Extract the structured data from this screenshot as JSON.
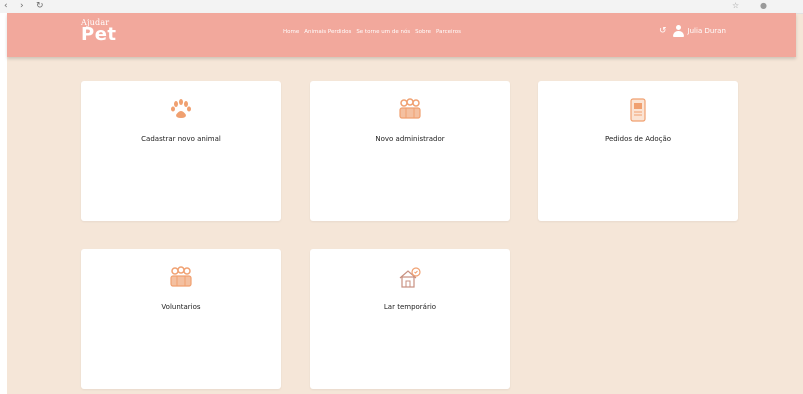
{
  "header": {
    "logo_small": "Ajudar",
    "logo_main": "Pet",
    "nav": [
      "Home",
      "Animais Perdidos",
      "Se torne um de nós",
      "Sobre",
      "Parceiros"
    ],
    "user_name": "Julia Duran",
    "bg_color": "#f2a89c"
  },
  "cards": [
    {
      "label": "Cadastrar novo animal",
      "icon": "paw-icon"
    },
    {
      "label": "Novo administrador",
      "icon": "people-icon"
    },
    {
      "label": "Pedidos de Adoção",
      "icon": "document-icon"
    },
    {
      "label": "Voluntarios",
      "icon": "people-icon"
    },
    {
      "label": "Lar temporário",
      "icon": "house-icon"
    }
  ],
  "colors": {
    "background": "#f5e6d8",
    "card": "#ffffff",
    "accent": "#f0a070"
  }
}
